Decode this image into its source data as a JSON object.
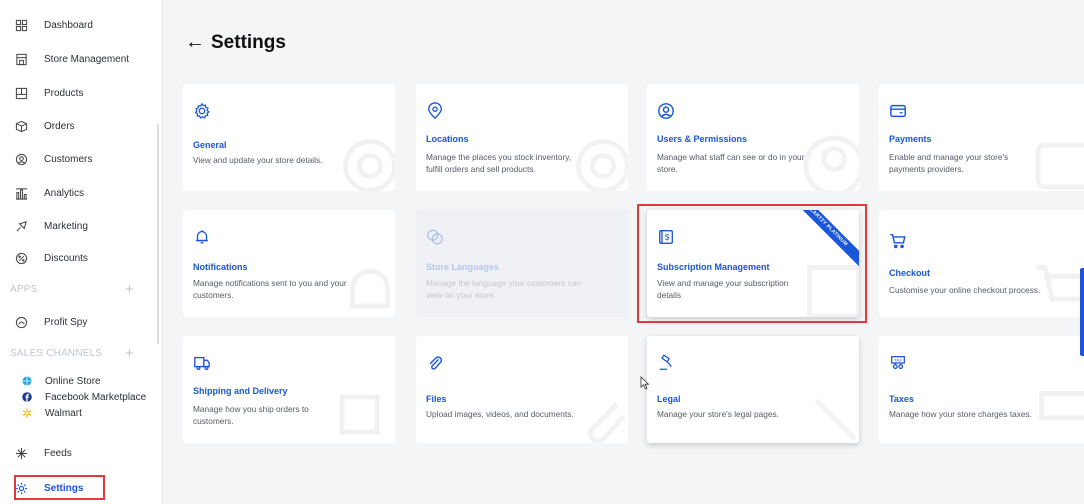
{
  "sidebar": {
    "items": [
      {
        "label": "Dashboard",
        "icon": "dashboard-icon"
      },
      {
        "label": "Store Management",
        "icon": "store-icon"
      },
      {
        "label": "Products",
        "icon": "products-icon"
      },
      {
        "label": "Orders",
        "icon": "orders-icon"
      },
      {
        "label": "Customers",
        "icon": "customers-icon"
      },
      {
        "label": "Analytics",
        "icon": "analytics-icon"
      },
      {
        "label": "Marketing",
        "icon": "marketing-icon"
      },
      {
        "label": "Discounts",
        "icon": "discounts-icon"
      }
    ],
    "apps_header": "APPS",
    "apps": [
      {
        "label": "Profit Spy",
        "icon": "profit-spy-icon"
      }
    ],
    "channels_header": "SALES CHANNELS",
    "channels": [
      {
        "label": "Online Store",
        "icon": "online-store-icon"
      },
      {
        "label": "Facebook Marketplace",
        "icon": "facebook-icon"
      },
      {
        "label": "Walmart",
        "icon": "walmart-icon"
      }
    ],
    "feeds": {
      "label": "Feeds",
      "icon": "feeds-icon"
    },
    "settings": {
      "label": "Settings",
      "icon": "settings-gear-icon"
    }
  },
  "main": {
    "title": "Settings",
    "back_icon": "arrow-left-icon",
    "cards": [
      {
        "title": "General",
        "desc": "View and update your store details.",
        "icon": "gear-icon"
      },
      {
        "title": "Locations",
        "desc": "Manage the places you stock inventory, fulfill orders and sell products.",
        "icon": "location-pin-icon"
      },
      {
        "title": "Users & Permissions",
        "desc": "Manage what staff can see or do in your store.",
        "icon": "user-circle-icon"
      },
      {
        "title": "Payments",
        "desc": "Enable and manage your store's payments providers.",
        "icon": "credit-card-icon"
      },
      {
        "title": "Notifications",
        "desc": "Manage notifications sent to you and your customers.",
        "icon": "bell-icon"
      },
      {
        "title": "Store Languages",
        "desc": "Manage the language your customers can view on your store.",
        "icon": "languages-icon"
      },
      {
        "title": "Subscription Management",
        "desc": "View and manage your subscription details",
        "icon": "dollar-document-icon",
        "ribbon": "CARTZY PLATINUM"
      },
      {
        "title": "Checkout",
        "desc": "Customise your online checkout process.",
        "icon": "cart-icon"
      },
      {
        "title": "Shipping and Delivery",
        "desc": "Manage how you ship orders to customers.",
        "icon": "truck-icon"
      },
      {
        "title": "Files",
        "desc": "Upload images, videos, and documents.",
        "icon": "paperclip-icon"
      },
      {
        "title": "Legal",
        "desc": "Manage your store's legal pages.",
        "icon": "gavel-icon"
      },
      {
        "title": "Taxes",
        "desc": "Manage how your store charges taxes.",
        "icon": "tax-receipt-icon"
      }
    ]
  },
  "colors": {
    "accent": "#1a56db",
    "highlight": "#e2393c",
    "background": "#f4f5f7"
  }
}
